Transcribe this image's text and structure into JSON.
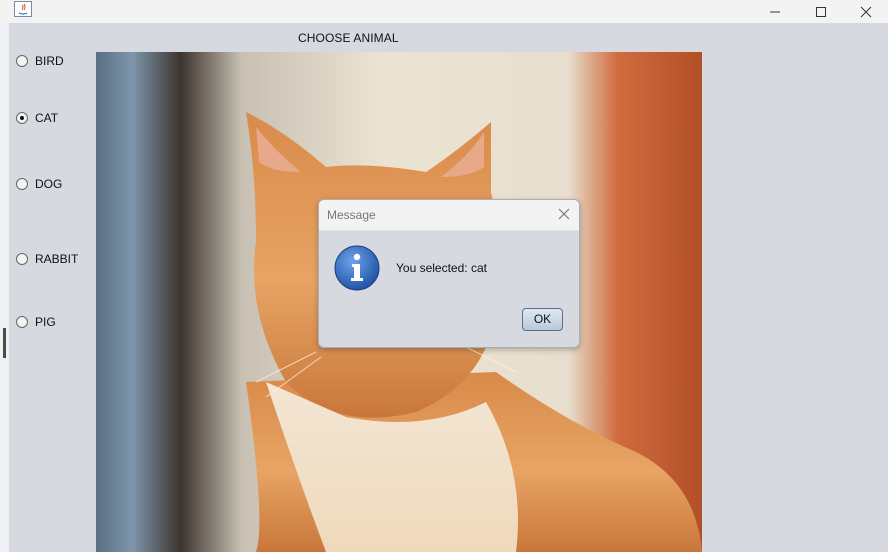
{
  "window": {
    "app_icon": "java-icon",
    "controls": [
      "minimize-icon",
      "maximize-icon",
      "close-icon"
    ]
  },
  "main": {
    "heading": "CHOOSE ANIMAL",
    "animals": [
      {
        "label": "BIRD",
        "selected": false
      },
      {
        "label": "CAT",
        "selected": true
      },
      {
        "label": "DOG",
        "selected": false
      },
      {
        "label": "RABBIT",
        "selected": false
      },
      {
        "label": "PIG",
        "selected": false
      }
    ]
  },
  "dialog": {
    "title": "Message",
    "icon": "info-icon",
    "message": "You selected: cat",
    "ok_label": "OK",
    "accent": "#2f64b9"
  }
}
